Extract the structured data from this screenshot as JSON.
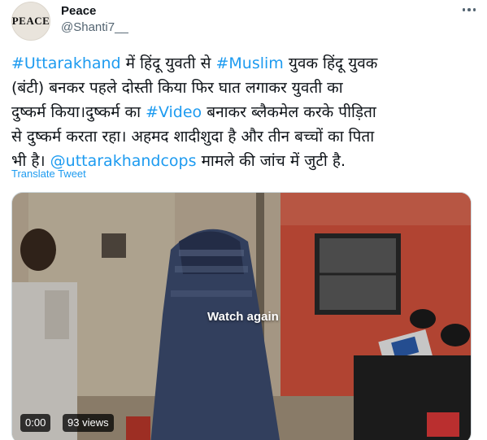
{
  "author": {
    "avatar_text": "PEACE",
    "name": "Peace",
    "handle": "@Shanti7__",
    "more_icon": "more-horizontal-icon"
  },
  "tweet": {
    "lines": [
      [
        {
          "text": "#Uttarakhand",
          "link": true
        },
        {
          "text": " में हिंदू युवती से ",
          "link": false
        },
        {
          "text": "#Muslim",
          "link": true
        },
        {
          "text": " युवक हिंदू युवक",
          "link": false
        }
      ],
      [
        {
          "text": "(बंटी) बनकर पहले दोस्ती किया फिर घात लगाकर युवती का",
          "link": false
        }
      ],
      [
        {
          "text": "दुष्कर्म किया।दुष्कर्म का ",
          "link": false
        },
        {
          "text": "#Video",
          "link": true
        },
        {
          "text": " बनाकर ब्लैकमेल करके पीड़िता",
          "link": false
        }
      ],
      [
        {
          "text": "से दुष्कर्म करता रहा। अहमद शादीशुदा है और तीन बच्चों का पिता",
          "link": false
        }
      ],
      [
        {
          "text": "भी है। ",
          "link": false
        },
        {
          "text": "@uttarakhandcops",
          "link": true
        },
        {
          "text": " मामले की जांच में जुटी है.",
          "link": false
        }
      ]
    ],
    "translate_label": "Translate Tweet"
  },
  "video": {
    "overlay_label": "Watch again",
    "time": "0:00",
    "views": "93 views"
  },
  "colors": {
    "link": "#1d9bf0",
    "text": "#0f1419",
    "secondary": "#536471"
  }
}
